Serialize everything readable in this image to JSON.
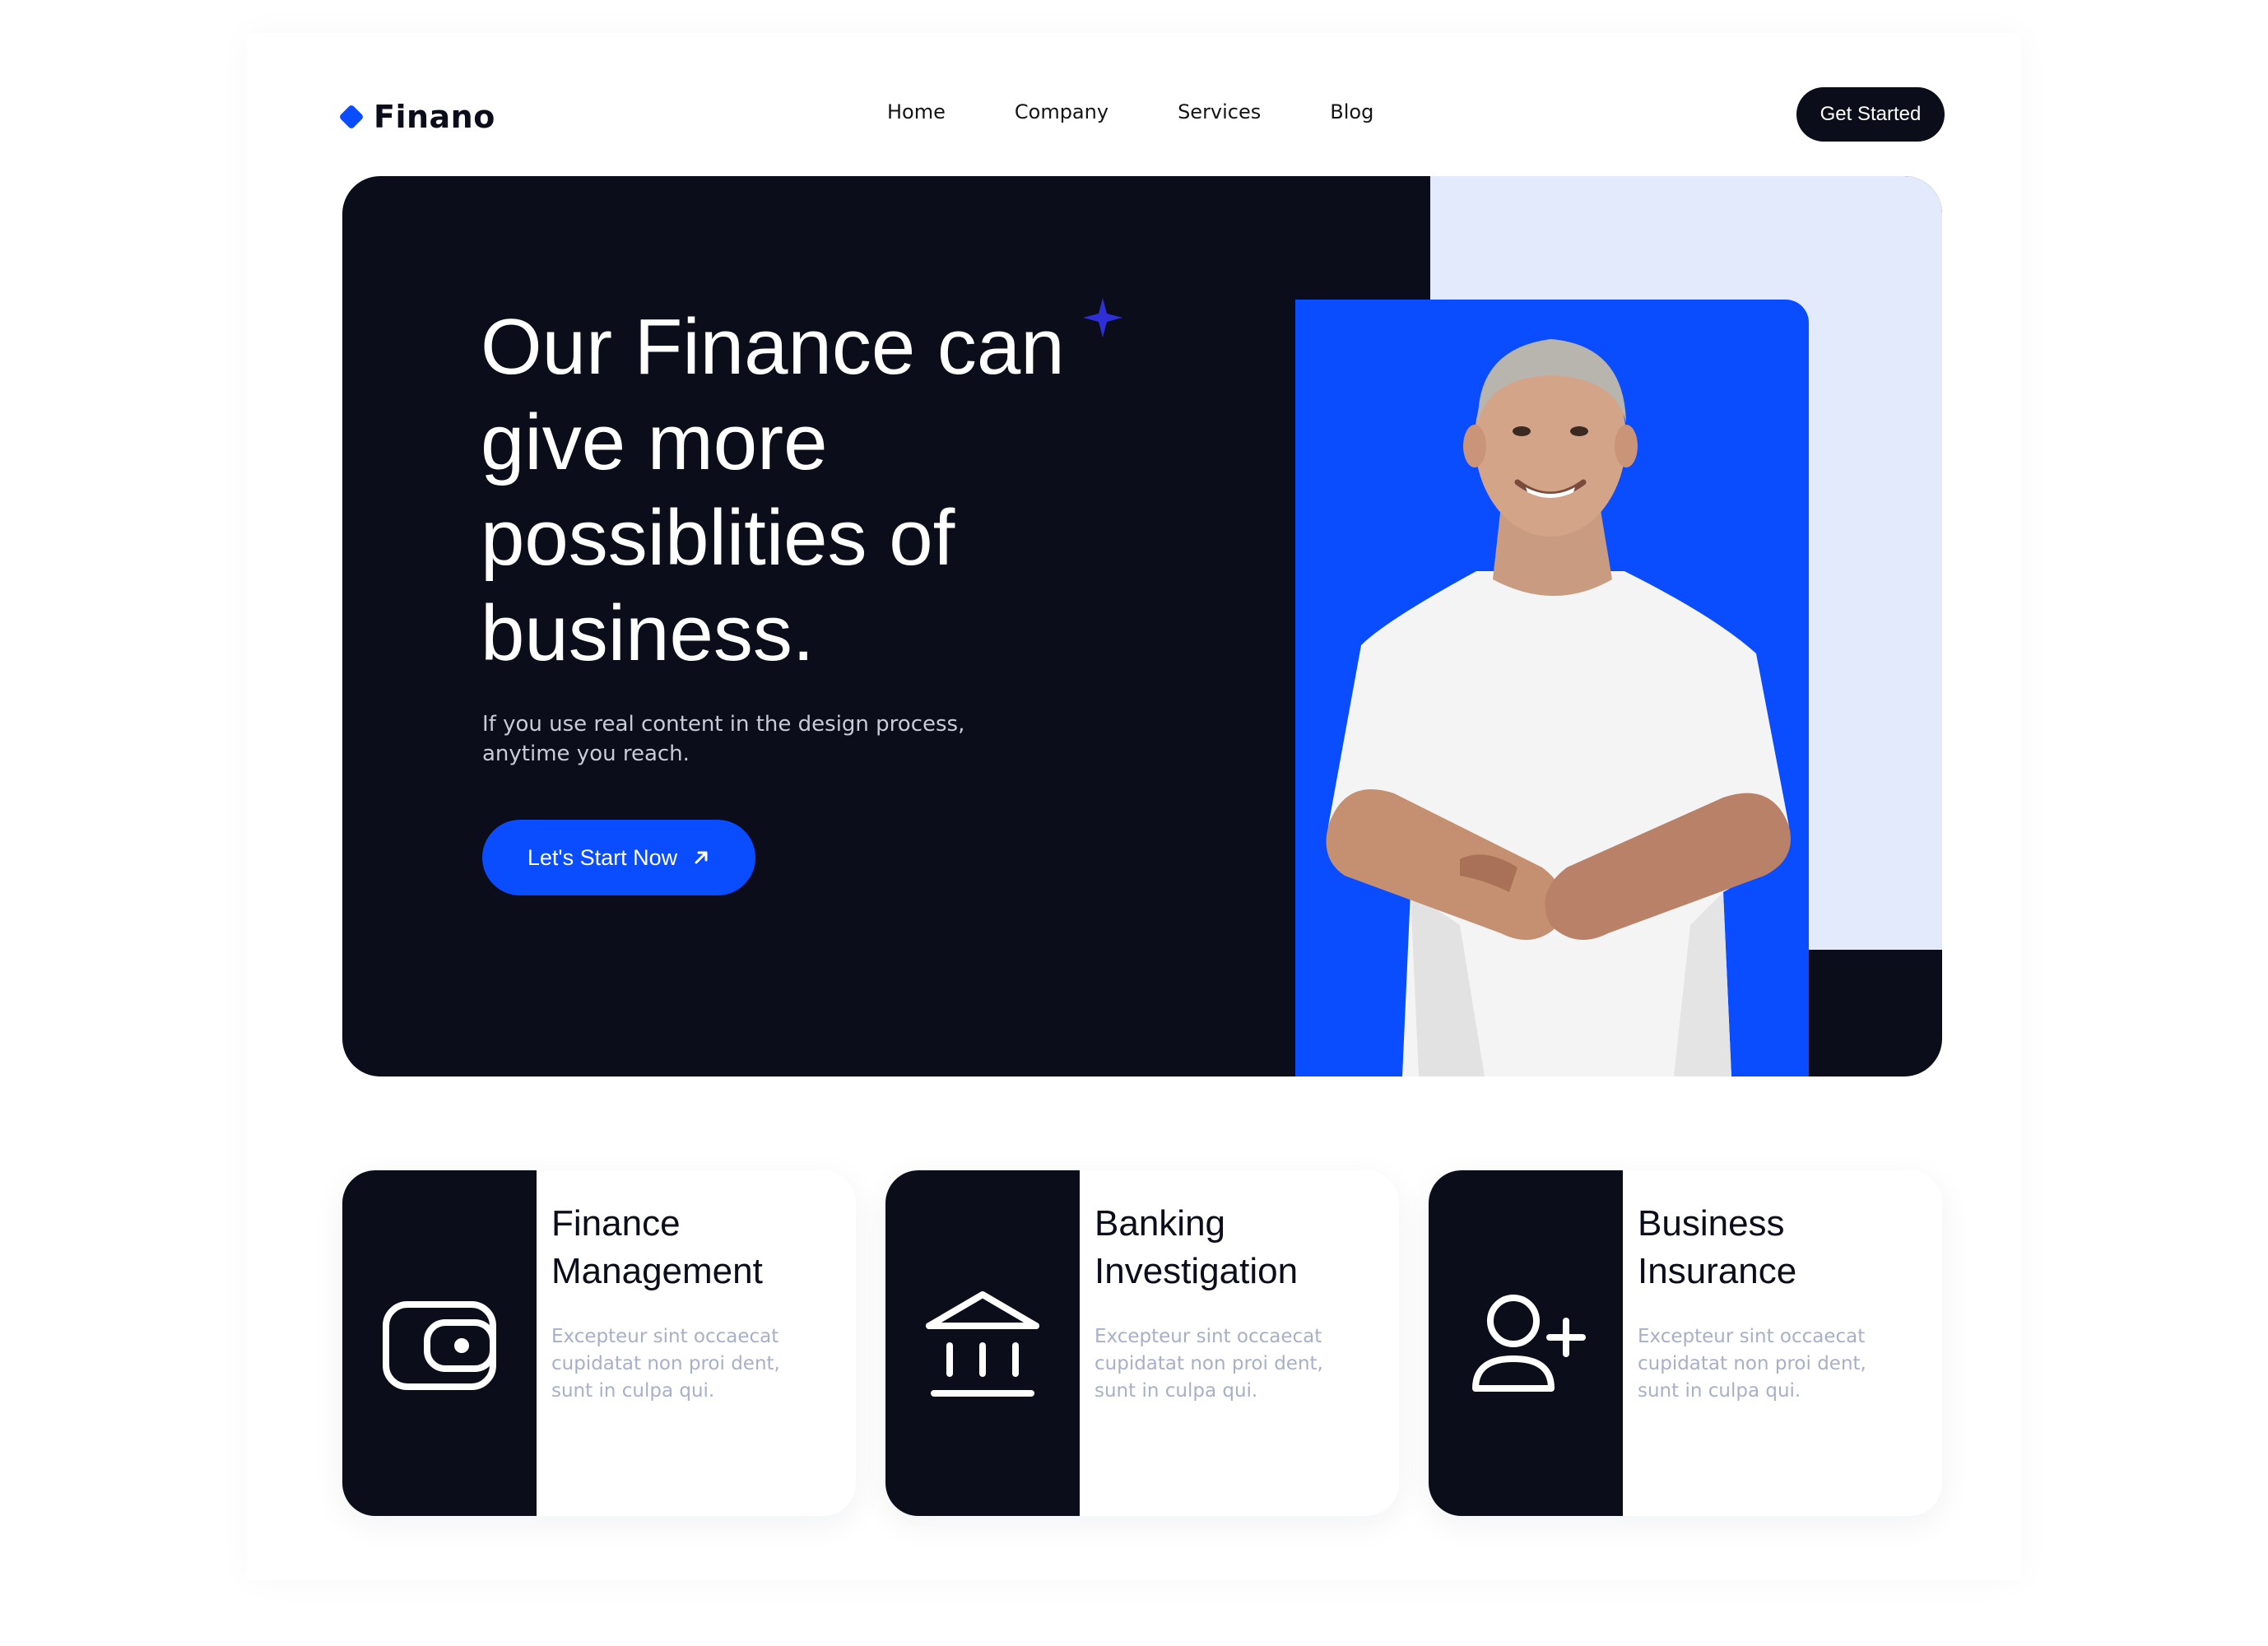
{
  "brand": {
    "name": "Finano",
    "accent_color": "#0a4cff",
    "dark_color": "#0b0e1a",
    "light_block_color": "#e3eafc"
  },
  "nav": {
    "items": [
      {
        "label": "Home"
      },
      {
        "label": "Company"
      },
      {
        "label": "Services"
      },
      {
        "label": "Blog"
      }
    ],
    "cta_label": "Get Started"
  },
  "hero": {
    "title": "Our Finance can give more possiblities of business.",
    "subtitle": "If you use real content in the design process, anytime you reach.",
    "cta_label": "Let's Start Now",
    "cta_icon": "arrow-up-right-icon",
    "decor_icon": "sparkle-icon"
  },
  "cards": [
    {
      "title": "Finance Management",
      "text": "Excepteur sint occaecat cupidatat non proi dent, sunt in culpa qui.",
      "icon": "wallet-icon"
    },
    {
      "title": "Banking Investigation",
      "text": "Excepteur sint occaecat cupidatat non proi dent, sunt in culpa qui.",
      "icon": "bank-icon"
    },
    {
      "title": "Business Insurance",
      "text": "Excepteur sint occaecat cupidatat non proi dent, sunt in culpa qui.",
      "icon": "add-user-icon"
    }
  ]
}
